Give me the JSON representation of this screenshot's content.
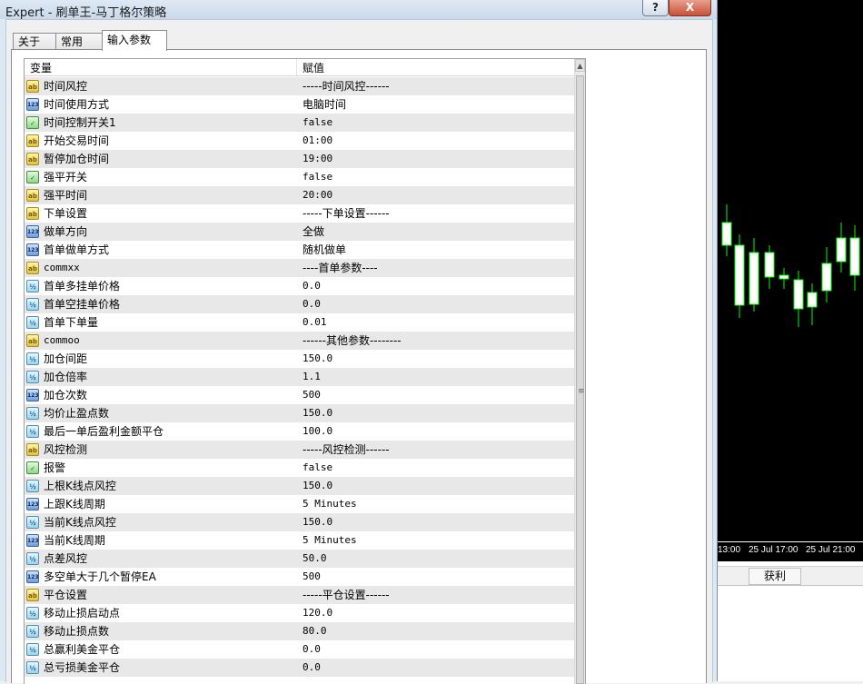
{
  "window": {
    "title": "Expert - 刷单王-马丁格尔策略",
    "help_label": "?",
    "close_label": "X"
  },
  "tabs": [
    {
      "label": "关于"
    },
    {
      "label": "常用"
    },
    {
      "label": "输入参数"
    }
  ],
  "grid": {
    "col_variable": "变量",
    "col_value": "赋值",
    "rows": [
      {
        "type": "ab",
        "name": "时间风控",
        "value": "-----时间风控------"
      },
      {
        "type": "123",
        "name": "时间使用方式",
        "value": "电脑时间"
      },
      {
        "type": "bool",
        "name": "时间控制开关1",
        "value": "false"
      },
      {
        "type": "ab",
        "name": "开始交易时间",
        "value": "01:00"
      },
      {
        "type": "ab",
        "name": "暂停加仓时间",
        "value": "19:00"
      },
      {
        "type": "bool",
        "name": "强平开关",
        "value": "false"
      },
      {
        "type": "ab",
        "name": "强平时间",
        "value": "20:00"
      },
      {
        "type": "ab",
        "name": "下单设置",
        "value": "-----下单设置------"
      },
      {
        "type": "123",
        "name": "做单方向",
        "value": "全做"
      },
      {
        "type": "123",
        "name": "首单做单方式",
        "value": "随机做单"
      },
      {
        "type": "ab",
        "name": "commxx",
        "value": "----首单参数----"
      },
      {
        "type": "dbl",
        "name": "首单多挂单价格",
        "value": "0.0"
      },
      {
        "type": "dbl",
        "name": "首单空挂单价格",
        "value": "0.0"
      },
      {
        "type": "dbl",
        "name": "首单下单量",
        "value": "0.01"
      },
      {
        "type": "ab",
        "name": "commoo",
        "value": "------其他参数--------"
      },
      {
        "type": "dbl",
        "name": "加仓间距",
        "value": "150.0"
      },
      {
        "type": "dbl",
        "name": "加仓倍率",
        "value": "1.1"
      },
      {
        "type": "123",
        "name": "加仓次数",
        "value": "500"
      },
      {
        "type": "dbl",
        "name": "均价止盈点数",
        "value": "150.0"
      },
      {
        "type": "dbl",
        "name": "最后一单后盈利金额平仓",
        "value": "100.0"
      },
      {
        "type": "ab",
        "name": "风控检测",
        "value": "-----风控检测------"
      },
      {
        "type": "bool",
        "name": "报警",
        "value": "false"
      },
      {
        "type": "dbl",
        "name": "上根K线点风控",
        "value": "150.0"
      },
      {
        "type": "123",
        "name": "上跟K线周期",
        "value": "5 Minutes"
      },
      {
        "type": "dbl",
        "name": "当前K线点风控",
        "value": "150.0"
      },
      {
        "type": "123",
        "name": "当前K线周期",
        "value": "5 Minutes"
      },
      {
        "type": "dbl",
        "name": "点差风控",
        "value": "50.0"
      },
      {
        "type": "123",
        "name": "多空单大于几个暂停EA",
        "value": "500"
      },
      {
        "type": "ab",
        "name": "平仓设置",
        "value": "-----平仓设置------"
      },
      {
        "type": "dbl",
        "name": "移动止损启动点",
        "value": "120.0"
      },
      {
        "type": "dbl",
        "name": "移动止损点数",
        "value": "80.0"
      },
      {
        "type": "dbl",
        "name": "总赢利美金平仓",
        "value": "0.0"
      },
      {
        "type": "dbl",
        "name": "总亏损美金平仓",
        "value": "0.0"
      }
    ]
  },
  "icons": {
    "ab": {
      "glyph": "ab",
      "name": "string-type-icon"
    },
    "123": {
      "glyph": "123",
      "name": "integer-type-icon"
    },
    "bool": {
      "glyph": "✓",
      "name": "bool-type-icon"
    },
    "dbl": {
      "glyph": "½",
      "name": "double-type-icon"
    }
  },
  "terminal": {
    "time_labels": [
      "13:00",
      "25 Jul 17:00",
      "25 Jul 21:00"
    ],
    "tab_label": "获利",
    "candle_color_up": "#ffffff",
    "wick_color": "#00ff00"
  }
}
